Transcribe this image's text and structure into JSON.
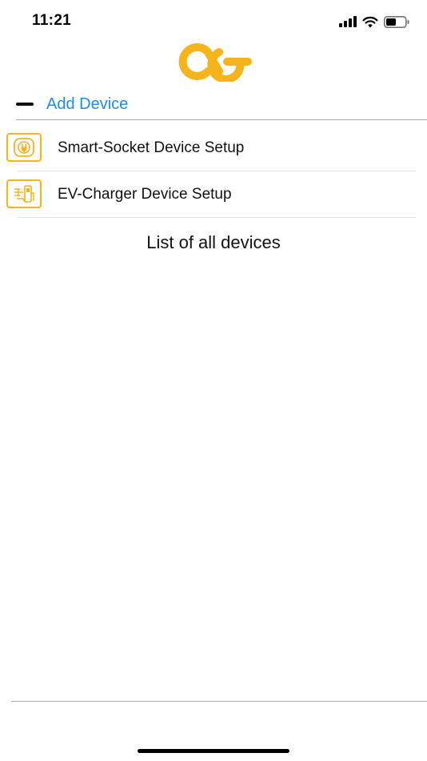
{
  "status_bar": {
    "time": "11:21",
    "icons": [
      "cellular-signal-icon",
      "wifi-icon",
      "battery-icon"
    ]
  },
  "brand": {
    "logo_icon": "brand-logo-icon",
    "accent_color": "#f5b31c"
  },
  "add_section": {
    "toggle_icon": "collapse-minus-icon",
    "label": "Add Device",
    "label_color": "#1a8cf0"
  },
  "devices": [
    {
      "label": "Smart-Socket Device Setup",
      "icon": "smart-socket-icon"
    },
    {
      "label": "EV-Charger Device Setup",
      "icon": "ev-charger-icon"
    }
  ],
  "list_title": "List of all devices"
}
